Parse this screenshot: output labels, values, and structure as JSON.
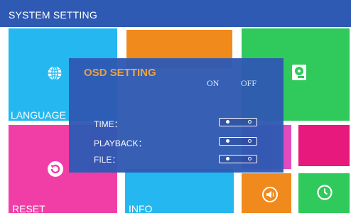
{
  "header": {
    "title": "SYSTEM SETTING"
  },
  "tiles": {
    "language": {
      "label": "LANGUAGE",
      "icon": "globe-icon"
    },
    "record": {
      "icon": ""
    },
    "storage": {
      "icon": "hard-disk-icon"
    },
    "reset": {
      "label": "RESET",
      "icon": "reset-icon"
    },
    "info": {
      "label": "INFO"
    },
    "volume": {
      "icon": "speaker-icon"
    },
    "clock": {
      "icon": "clock-icon"
    }
  },
  "osd": {
    "title": "OSD SETTING",
    "col_on": "ON",
    "col_off": "OFF",
    "rows": [
      {
        "label": "TIME：",
        "value": "ON"
      },
      {
        "label": "PLAYBACK：",
        "value": "ON"
      },
      {
        "label": "FILE：",
        "value": "ON"
      }
    ]
  },
  "colors": {
    "header": "#2f5ab3",
    "osd_title": "#f2a13a",
    "cyan": "#25b8f0",
    "orange": "#f18a1c",
    "green": "#2fca5b",
    "pink": "#f13ea7",
    "magenta": "#e8197c"
  }
}
